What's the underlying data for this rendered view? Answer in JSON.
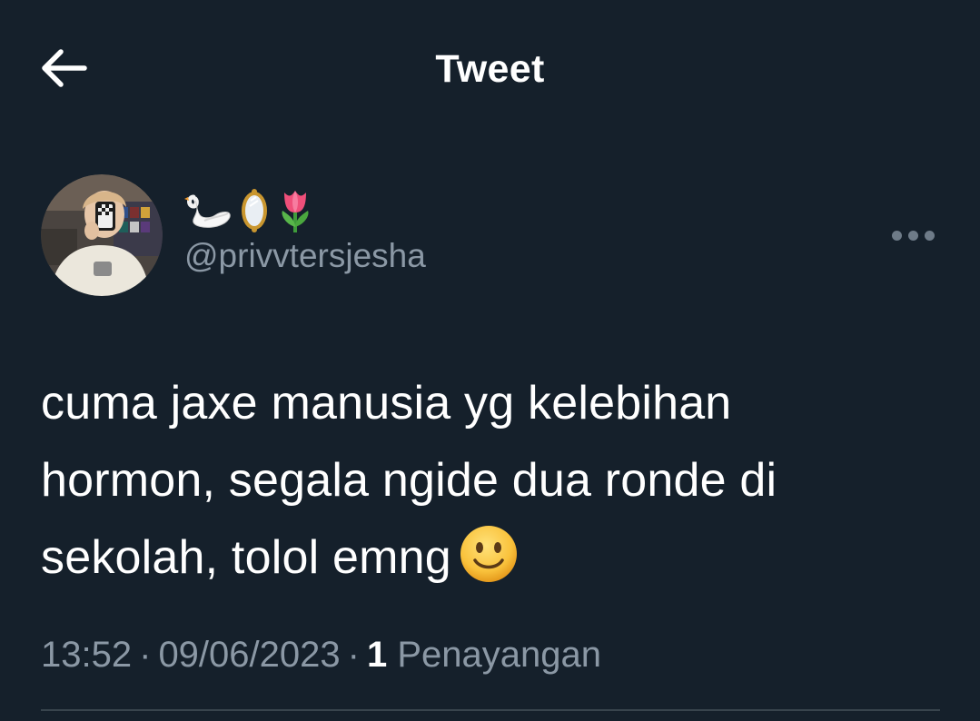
{
  "header": {
    "title": "Tweet",
    "back_icon": "arrow-left-icon"
  },
  "author": {
    "display_name_icons": [
      "swan-icon",
      "mirror-icon",
      "tulip-icon"
    ],
    "handle": "@privvtersjesha"
  },
  "tweet": {
    "lines": [
      "cuma jaxe manusia yg kelebihan",
      "hormon, segala ngide dua ronde di",
      "sekolah, tolol emng"
    ],
    "trailing_emoji": "slightly-smiling-face-icon"
  },
  "meta": {
    "time": "13:52",
    "separator": "·",
    "date": "09/06/2023",
    "views_count": "1",
    "views_label": "Penayangan"
  },
  "colors": {
    "background": "#15202b",
    "secondary_text": "#8b98a5",
    "divider": "#38444d"
  }
}
